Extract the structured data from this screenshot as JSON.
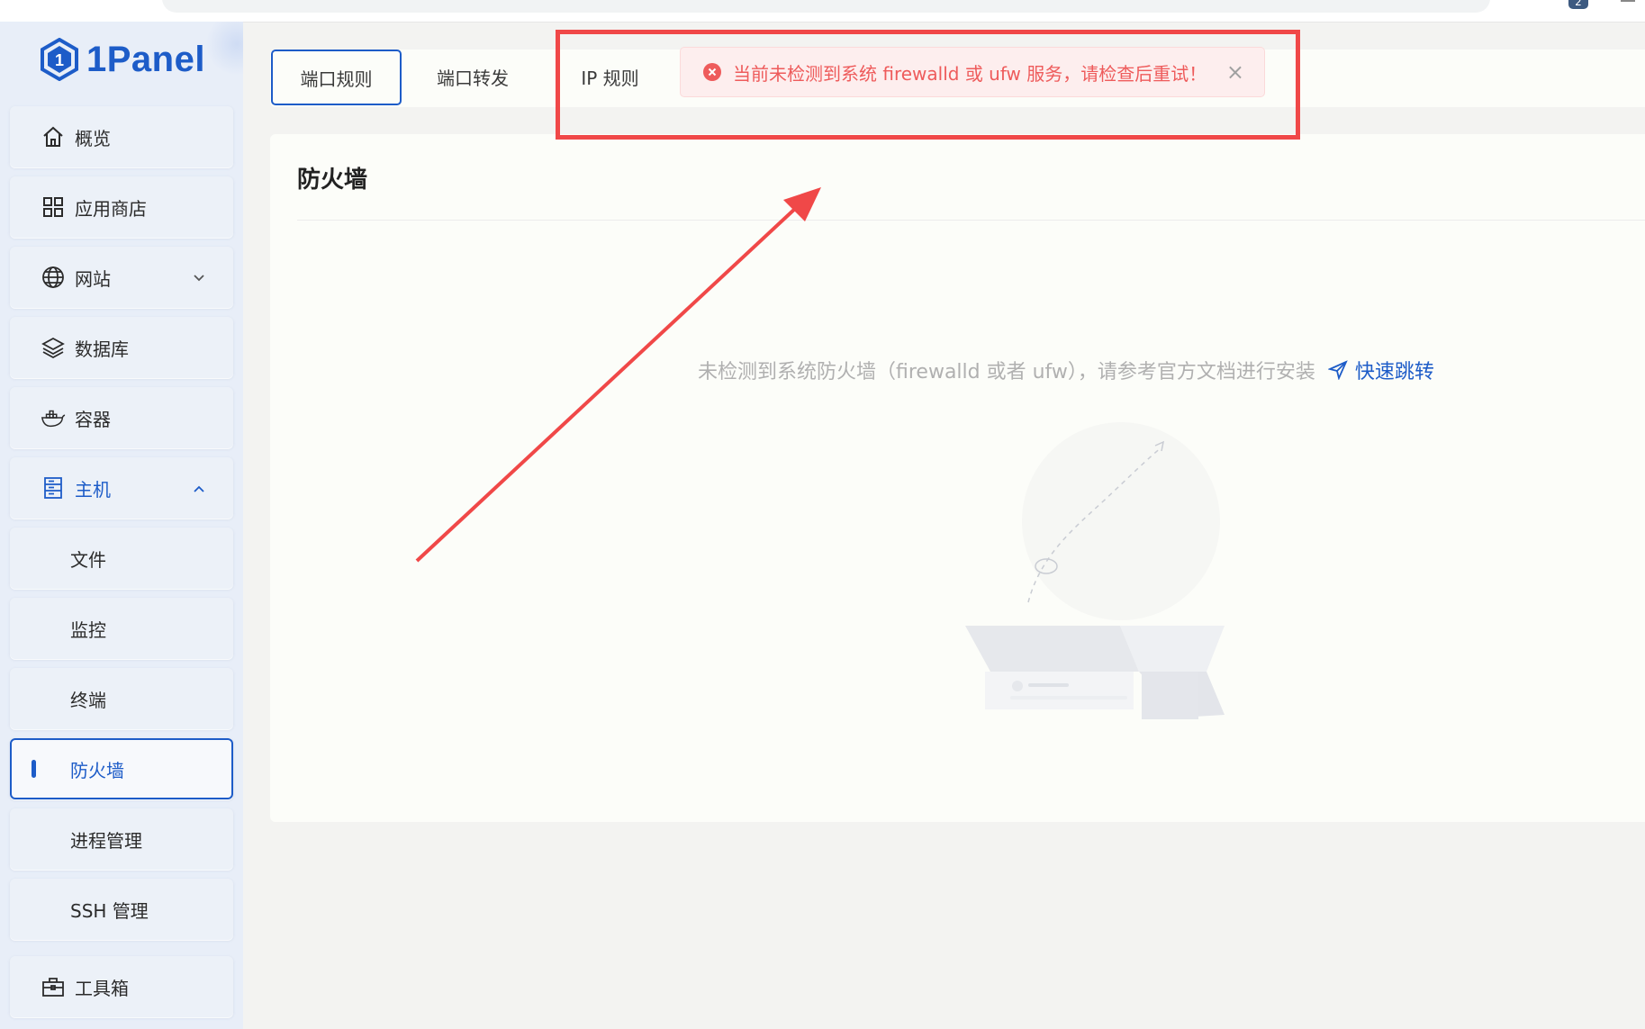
{
  "browser": {
    "extension_badge": "2"
  },
  "app": {
    "logo_text": "1Panel"
  },
  "sidebar": {
    "items": [
      {
        "label": "概览",
        "icon": "home-icon"
      },
      {
        "label": "应用商店",
        "icon": "app-grid-icon"
      },
      {
        "label": "网站",
        "icon": "globe-icon"
      },
      {
        "label": "数据库",
        "icon": "layers-icon"
      },
      {
        "label": "容器",
        "icon": "docker-whale-icon"
      },
      {
        "label": "主机",
        "icon": "server-icon"
      },
      {
        "label": "文件"
      },
      {
        "label": "监控"
      },
      {
        "label": "终端"
      },
      {
        "label": "防火墙"
      },
      {
        "label": "进程管理"
      },
      {
        "label": "SSH 管理"
      },
      {
        "label": "工具箱",
        "icon": "toolbox-icon"
      }
    ]
  },
  "tabs": [
    {
      "label": "端口规则",
      "active": true
    },
    {
      "label": "端口转发"
    },
    {
      "label": "IP 规则"
    }
  ],
  "toast": {
    "type": "error",
    "message": "当前未检测到系统 firewalld 或 ufw 服务，请检查后重试！",
    "close": "×"
  },
  "card": {
    "title": "防火墙",
    "empty_text": "未检测到系统防火墙（firewalld 或者 ufw），请参考官方文档进行安装",
    "link_label": "快速跳转"
  },
  "colors": {
    "accent": "#1d5cc8",
    "error_text": "#ee5b5b",
    "error_bg": "#fdeeee",
    "annotation_red": "#f04848"
  }
}
